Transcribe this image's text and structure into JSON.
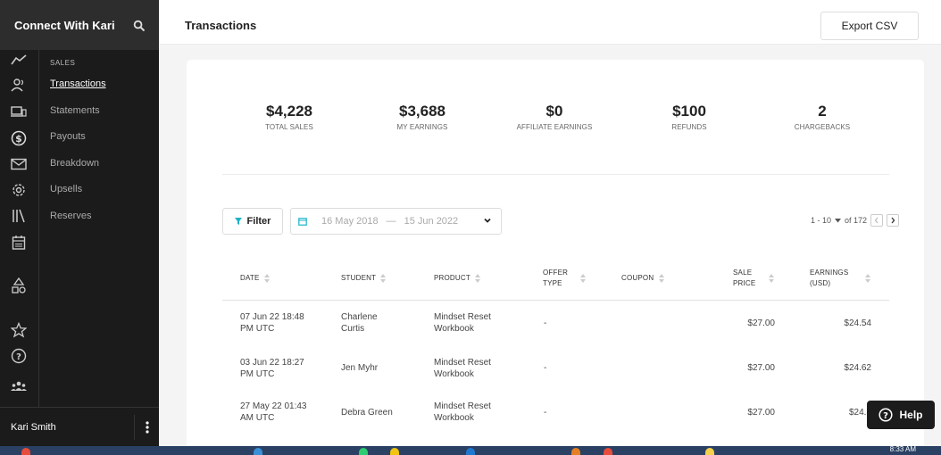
{
  "sidebar": {
    "title": "Connect With Kari",
    "section": "SALES",
    "items": [
      {
        "label": "Transactions",
        "active": true
      },
      {
        "label": "Statements"
      },
      {
        "label": "Payouts"
      },
      {
        "label": "Breakdown"
      },
      {
        "label": "Upsells"
      },
      {
        "label": "Reserves"
      }
    ],
    "user": "Kari Smith",
    "rail_icons": [
      "analytics-icon",
      "people-icon",
      "devices-icon",
      "dollar-icon",
      "mail-icon",
      "settings-icon",
      "library-icon",
      "calendar-icon",
      "shapes-icon",
      "star-icon",
      "help-circle-icon",
      "community-icon"
    ]
  },
  "header": {
    "title": "Transactions",
    "export_label": "Export CSV"
  },
  "stats": [
    {
      "value": "$4,228",
      "label": "TOTAL SALES"
    },
    {
      "value": "$3,688",
      "label": "MY EARNINGS"
    },
    {
      "value": "$0",
      "label": "AFFILIATE EARNINGS"
    },
    {
      "value": "$100",
      "label": "REFUNDS"
    },
    {
      "value": "2",
      "label": "CHARGEBACKS"
    }
  ],
  "toolbar": {
    "filter_label": "Filter",
    "date_start": "16 May 2018",
    "date_sep": "—",
    "date_end": "15 Jun 2022",
    "pagination": "1 - 10",
    "pagination_total": "of 172"
  },
  "table": {
    "columns": [
      {
        "l1": "DATE",
        "l2": ""
      },
      {
        "l1": "STUDENT",
        "l2": ""
      },
      {
        "l1": "PRODUCT",
        "l2": ""
      },
      {
        "l1": "OFFER",
        "l2": "TYPE"
      },
      {
        "l1": "COUPON",
        "l2": ""
      },
      {
        "l1": "SALE",
        "l2": "PRICE"
      },
      {
        "l1": "EARNINGS",
        "l2": "(USD)"
      }
    ],
    "rows": [
      {
        "date1": "07 Jun 22 18:48",
        "date2": "PM UTC",
        "student1": "Charlene",
        "student2": "Curtis",
        "product1": "Mindset Reset",
        "product2": "Workbook",
        "offer": "-",
        "coupon": "",
        "price": "$27.00",
        "earnings": "$24.54"
      },
      {
        "date1": "03 Jun 22 18:27",
        "date2": "PM UTC",
        "student1": "Jen Myhr",
        "student2": "",
        "product1": "Mindset Reset",
        "product2": "Workbook",
        "offer": "-",
        "coupon": "",
        "price": "$27.00",
        "earnings": "$24.62"
      },
      {
        "date1": "27 May 22 01:43",
        "date2": "AM UTC",
        "student1": "Debra Green",
        "student2": "",
        "product1": "Mindset Reset",
        "product2": "Workbook",
        "offer": "-",
        "coupon": "",
        "price": "$27.00",
        "earnings": "$24.5"
      }
    ]
  },
  "help_label": "Help",
  "taskbar": {
    "clock": "8:33 AM"
  },
  "colors": {
    "sidebar": "#1b1b1b",
    "brand_bar": "#2d2d2d",
    "accent_cyan": "#1ab3c9",
    "help_bg": "#1c1c1c",
    "taskbar": "#2a4164"
  }
}
